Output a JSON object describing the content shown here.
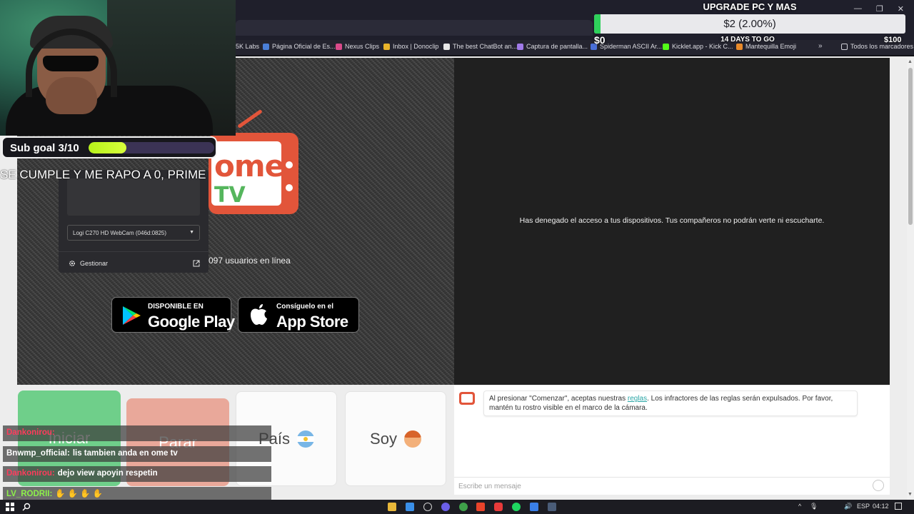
{
  "bookmarks": [
    {
      "label": "5K Labs",
      "color": "#8a8aa0"
    },
    {
      "label": "Página Oficial de Es...",
      "color": "#4a7fd8"
    },
    {
      "label": "Nexus Clips",
      "color": "#d94a8a"
    },
    {
      "label": "Inbox | Donoclip",
      "color": "#e8b32a"
    },
    {
      "label": "The best ChatBot an...",
      "color": "#e8e8e8"
    },
    {
      "label": "Captura de pantalla...",
      "color": "#a07ae8"
    },
    {
      "label": "Spiderman ASCII Ar...",
      "color": "#4a6fd8"
    },
    {
      "label": "Kicklet.app - Kick C...",
      "color": "#53fc18"
    },
    {
      "label": "Mantequilla Emoji",
      "color": "#e88a2a"
    }
  ],
  "bookmarks_more": "»",
  "bookmarks_all": "Todos los marcadores",
  "window_controls": {
    "minimize": "—",
    "restore": "❐",
    "close": "✕"
  },
  "upgrade_goal": {
    "title": "UPGRADE PC Y MAS",
    "amount": "$2 (2.00%)",
    "progress_percent": 2,
    "min": "$0",
    "max": "$100",
    "days": "14 DAYS TO GO"
  },
  "sub_goal": {
    "label": "Sub goal 3/10",
    "progress": 0.3,
    "caption": "SE CUMPLE Y ME RAPO A 0, PRIME"
  },
  "omegle": {
    "logo_ome": "ome",
    "logo_tv": "TV",
    "users_online": "097 usuarios en línea",
    "device_select": "Logi C270 HD WebCam (046d:0825)",
    "manage": "Gestionar",
    "google_play_small": "DISPONIBLE EN",
    "google_play_big": "Google Play",
    "app_store_small": "Consíguelo en el",
    "app_store_big": "App Store",
    "denied_message": "Has denegado el acceso a tus dispositivos. Tus compañeros no podrán verte ni escucharte."
  },
  "buttons": {
    "start": "Iniciar",
    "stop": "Parar",
    "country": "País",
    "gender": "Soy"
  },
  "chat": {
    "notice_before": "Al presionar \"Comenzar\", aceptas nuestras ",
    "notice_link": "reglas",
    "notice_after": ". Los infractores de las reglas serán expulsados. Por favor, mantén tu rostro visible en el marco de la cámara.",
    "input_placeholder": "Escribe un mensaje"
  },
  "stream_chat": [
    {
      "user": "Dankonirou:",
      "text": "",
      "color": "#ff3b5c"
    },
    {
      "user": "Bnwmp_official:",
      "text": "lis tambien anda en ome tv",
      "color": "#ffffff"
    },
    {
      "user": "Dankonirou:",
      "text": "dejo view apoyin respetin",
      "color": "#ff3b5c"
    },
    {
      "user": "LV_RODRII:",
      "text": "✋ ✋ ✋ ✋",
      "color": "#8df04a"
    }
  ],
  "taskbar": {
    "lang": "ESP",
    "time": "04:12"
  },
  "colors": {
    "accent_orange": "#e2553a",
    "accent_green": "#55b65d",
    "goal_green": "#2fd15b",
    "subgoal_fill": "#c8f522"
  }
}
